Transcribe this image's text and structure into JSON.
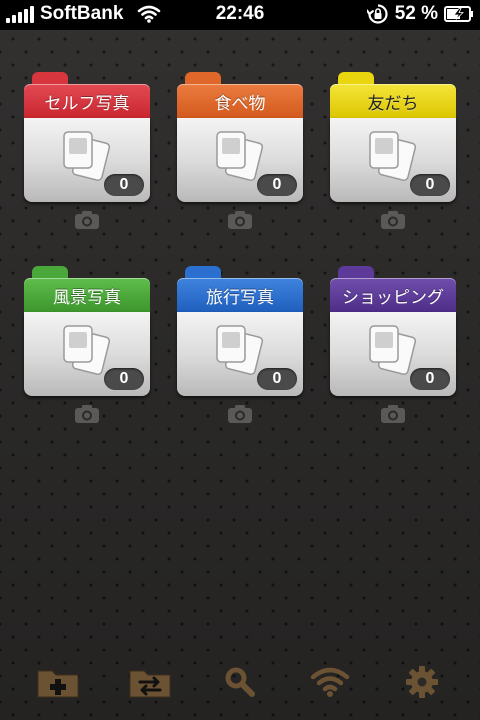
{
  "status_bar": {
    "carrier": "SoftBank",
    "time": "22:46",
    "battery_percent": "52 %",
    "icons": [
      "signal-icon",
      "wifi-icon",
      "rotation-lock-icon",
      "battery-charging-icon"
    ]
  },
  "folders": [
    {
      "label": "セルフ写真",
      "count": "0",
      "color": "#d7363f"
    },
    {
      "label": "食べ物",
      "count": "0",
      "color": "#e0672a"
    },
    {
      "label": "友だち",
      "count": "0",
      "color": "#e9d60f"
    },
    {
      "label": "風景写真",
      "count": "0",
      "color": "#4aa83a"
    },
    {
      "label": "旅行写真",
      "count": "0",
      "color": "#2b6fd0"
    },
    {
      "label": "ショッピング",
      "count": "0",
      "color": "#5d3a9a"
    }
  ],
  "toolbar": {
    "icons": [
      "new-folder-icon",
      "move-folder-icon",
      "search-icon",
      "wifi-icon",
      "settings-icon"
    ],
    "icon_color": "#6b5233"
  }
}
